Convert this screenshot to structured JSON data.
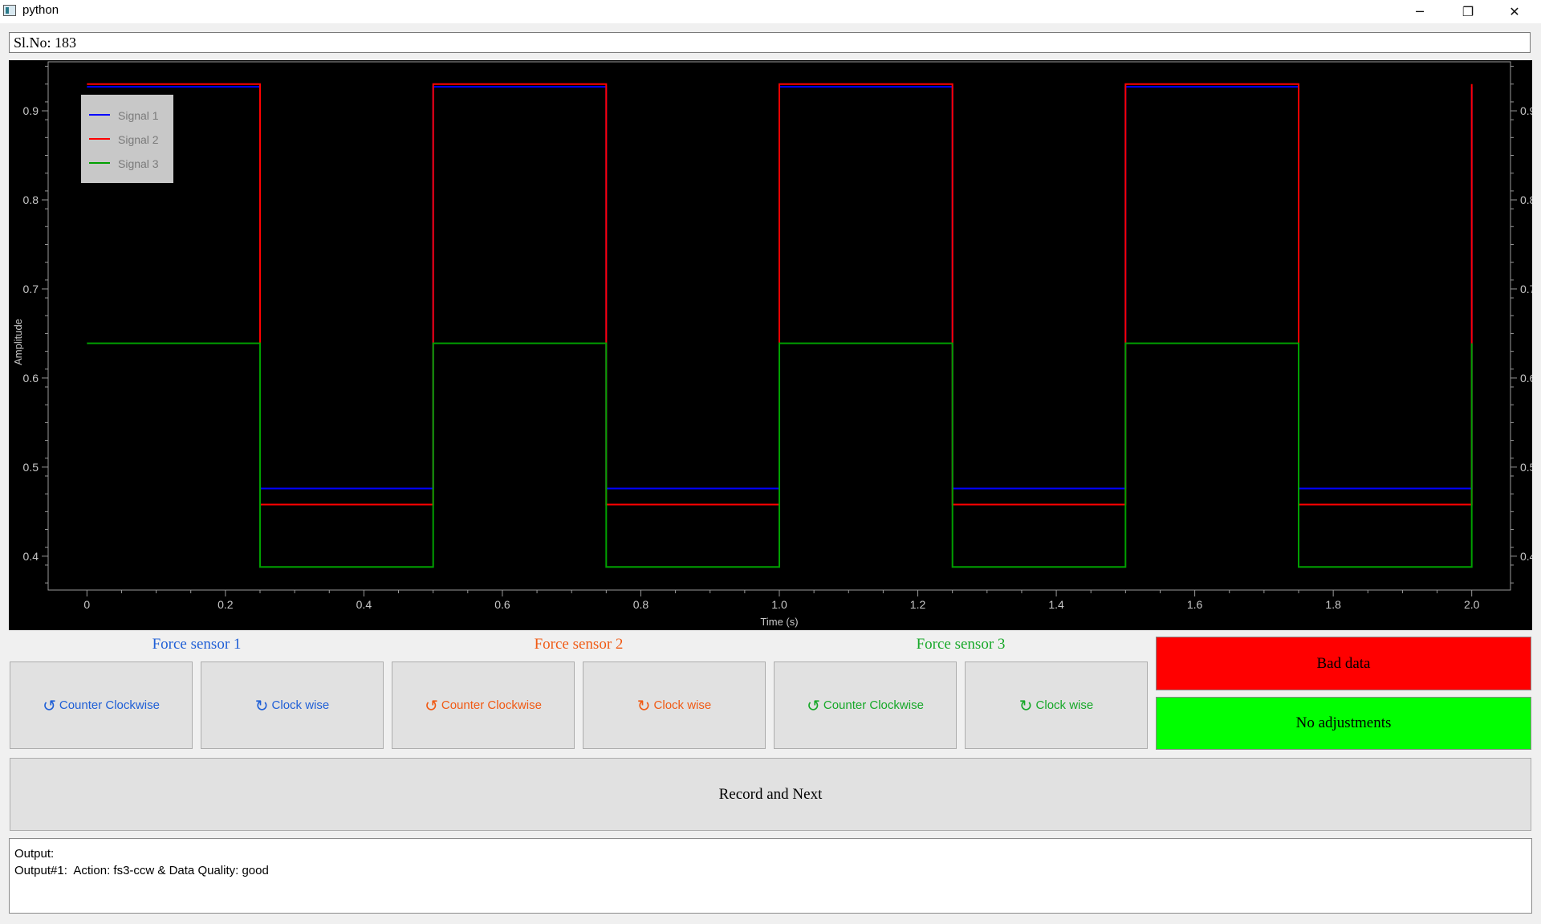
{
  "window": {
    "title": "python",
    "minimize_glyph": "─",
    "restore_glyph": "❐",
    "close_glyph": "✕"
  },
  "serial_field": {
    "value": "Sl.No: 183"
  },
  "chart_data": {
    "type": "line",
    "xlabel": "Time (s)",
    "ylabel": "Amplitude",
    "xlim": [
      -0.056,
      2.056
    ],
    "ylim": [
      0.362,
      0.955
    ],
    "x_ticks": [
      0,
      0.2,
      0.4,
      0.6,
      0.8,
      1.0,
      1.2,
      1.4,
      1.6,
      1.8,
      2.0
    ],
    "x_tick_labels": [
      "0",
      "0.2",
      "0.4",
      "0.6",
      "0.8",
      "1.0",
      "1.2",
      "1.4",
      "1.6",
      "1.8",
      "2.0"
    ],
    "y_ticks": [
      0.4,
      0.5,
      0.6,
      0.7,
      0.8,
      0.9
    ],
    "y_tick_labels": [
      "0.4",
      "0.5",
      "0.6",
      "0.7",
      "0.8",
      "0.9"
    ],
    "grid": false,
    "legend_position": "top-left",
    "series": [
      {
        "name": "Signal 1",
        "color": "#0000ff",
        "x": [
          0,
          0.25,
          0.25,
          0.5,
          0.5,
          0.75,
          0.75,
          1.0,
          1.0,
          1.25,
          1.25,
          1.5,
          1.5,
          1.75,
          1.75,
          2.0,
          2.0
        ],
        "y": [
          0.927,
          0.927,
          0.476,
          0.476,
          0.927,
          0.927,
          0.476,
          0.476,
          0.927,
          0.927,
          0.476,
          0.476,
          0.927,
          0.927,
          0.476,
          0.476,
          0.927
        ]
      },
      {
        "name": "Signal 2",
        "color": "#ff0000",
        "x": [
          0,
          0.25,
          0.25,
          0.5,
          0.5,
          0.75,
          0.75,
          1.0,
          1.0,
          1.25,
          1.25,
          1.5,
          1.5,
          1.75,
          1.75,
          2.0,
          2.0
        ],
        "y": [
          0.93,
          0.93,
          0.458,
          0.458,
          0.93,
          0.93,
          0.458,
          0.458,
          0.93,
          0.93,
          0.458,
          0.458,
          0.93,
          0.93,
          0.458,
          0.458,
          0.93
        ]
      },
      {
        "name": "Signal 3",
        "color": "#00a000",
        "x": [
          0,
          0.25,
          0.25,
          0.5,
          0.5,
          0.75,
          0.75,
          1.0,
          1.0,
          1.25,
          1.25,
          1.5,
          1.5,
          1.75,
          1.75,
          2.0,
          2.0
        ],
        "y": [
          0.639,
          0.639,
          0.388,
          0.388,
          0.639,
          0.639,
          0.388,
          0.388,
          0.639,
          0.639,
          0.388,
          0.388,
          0.639,
          0.639,
          0.388,
          0.388,
          0.639
        ]
      }
    ]
  },
  "sensors": [
    {
      "title": "Force sensor 1",
      "color": "#1f5fd6",
      "ccw_label": "Counter Clockwise",
      "cw_label": "Clock wise"
    },
    {
      "title": "Force sensor 2",
      "color": "#f05a14",
      "ccw_label": "Counter Clockwise",
      "cw_label": "Clock wise"
    },
    {
      "title": "Force sensor 3",
      "color": "#16a828",
      "ccw_label": "Counter Clockwise",
      "cw_label": "Clock wise"
    }
  ],
  "icons": {
    "ccw": "↺",
    "cw": "↻"
  },
  "bad_data": {
    "label": "Bad data",
    "color": "#ff0000"
  },
  "no_adjustments": {
    "label": "No adjustments",
    "color": "#00ff00"
  },
  "record_next": {
    "label": "Record and Next"
  },
  "output": {
    "header": "Output:",
    "lines": [
      "Output#1:  Action: fs3-ccw & Data Quality: good"
    ]
  }
}
